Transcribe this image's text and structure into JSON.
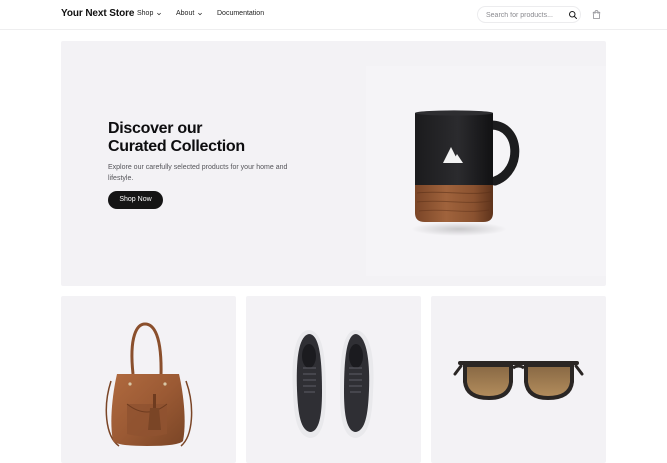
{
  "header": {
    "logo": "Your Next Store",
    "nav": [
      {
        "label": "Shop",
        "has_dropdown": true
      },
      {
        "label": "About",
        "has_dropdown": true
      },
      {
        "label": "Documentation",
        "has_dropdown": false
      }
    ],
    "search": {
      "placeholder": "Search for products...",
      "value": "",
      "icon": "search-icon"
    },
    "cart_icon": "shopping-bag-icon"
  },
  "hero": {
    "title_line1": "Discover our",
    "title_line2": "Curated Collection",
    "description": "Explore our carefully selected products for your home and lifestyle.",
    "cta_label": "Shop Now",
    "image": "black-mug-with-wood-base"
  },
  "products": [
    {
      "image": "brown-leather-handbag"
    },
    {
      "image": "black-sneakers"
    },
    {
      "image": "sunglasses"
    }
  ],
  "colors": {
    "background": "#ffffff",
    "panel": "#f3f2f5",
    "button": "#151515",
    "text": "#111111"
  }
}
